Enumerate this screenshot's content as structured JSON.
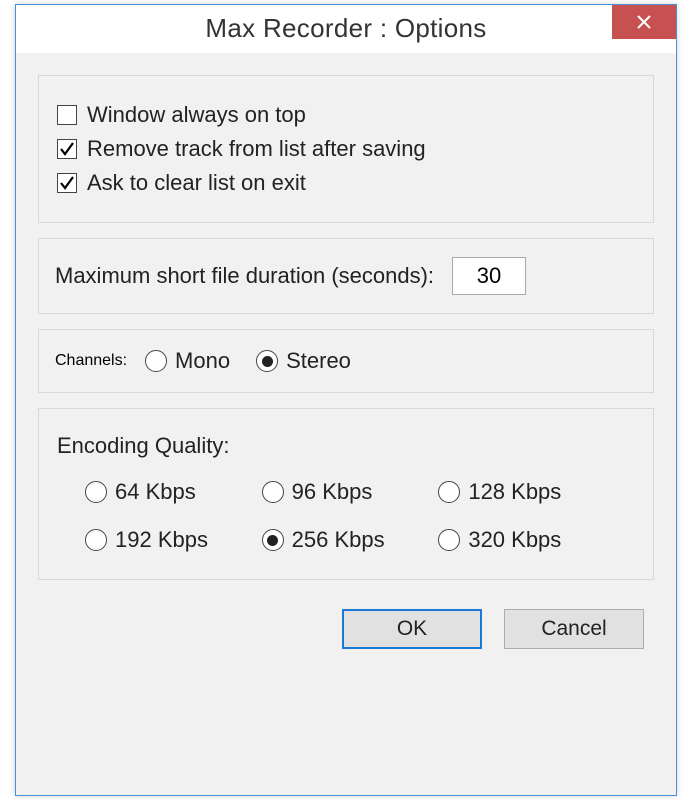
{
  "titlebar": {
    "title": "Max Recorder : Options"
  },
  "checkboxes": {
    "always_on_top": {
      "label": "Window always on top",
      "checked": false
    },
    "remove_track": {
      "label": "Remove track from list after saving",
      "checked": true
    },
    "ask_clear": {
      "label": "Ask to clear list on exit",
      "checked": true
    }
  },
  "duration": {
    "label": "Maximum short file duration (seconds):",
    "value": "30"
  },
  "channels": {
    "label": "Channels:",
    "options": [
      {
        "label": "Mono",
        "selected": false
      },
      {
        "label": "Stereo",
        "selected": true
      }
    ]
  },
  "quality": {
    "label": "Encoding Quality:",
    "options": [
      {
        "label": "64 Kbps",
        "selected": false
      },
      {
        "label": "96 Kbps",
        "selected": false
      },
      {
        "label": "128 Kbps",
        "selected": false
      },
      {
        "label": "192 Kbps",
        "selected": false
      },
      {
        "label": "256 Kbps",
        "selected": true
      },
      {
        "label": "320 Kbps",
        "selected": false
      }
    ]
  },
  "buttons": {
    "ok": "OK",
    "cancel": "Cancel"
  }
}
